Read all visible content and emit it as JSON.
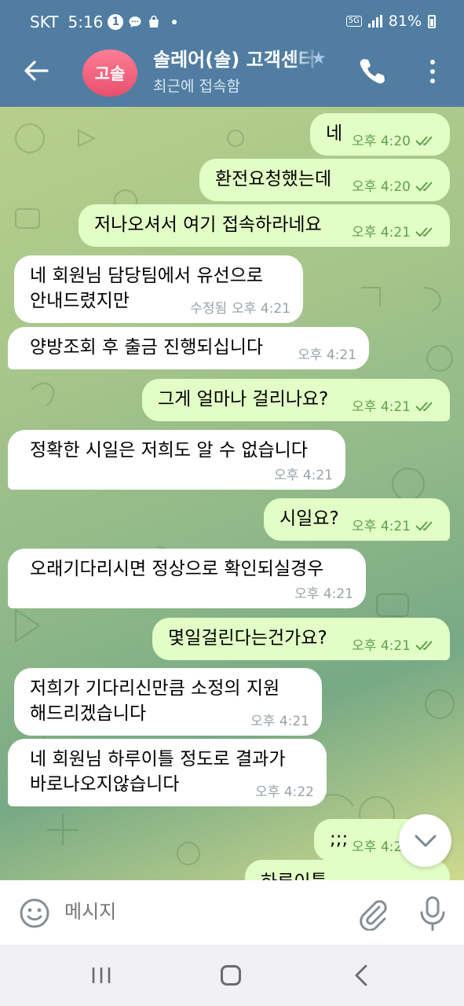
{
  "status_bar": {
    "carrier": "SKT",
    "time": "5:16",
    "notification_count": "1",
    "network": "5G",
    "battery": "81%"
  },
  "header": {
    "avatar_initials": "고솔",
    "title": "솔레어(솔) 고객센터",
    "subtitle": "최근에 접속함"
  },
  "messages": [
    {
      "dir": "out",
      "text": "네",
      "time": "오후 4:20"
    },
    {
      "dir": "out",
      "text": "환전요청했는데",
      "time": "오후 4:20"
    },
    {
      "dir": "out",
      "text": "저나오셔서 여기 접속하라네요",
      "time": "오후 4:21"
    },
    {
      "dir": "in",
      "lines": [
        "네 회원님 담당팀에서 유선으로",
        "안내드렸지만"
      ],
      "edited": "수정됨",
      "time": "오후 4:21"
    },
    {
      "dir": "in",
      "text": "양방조회 후 출금 진행되십니다",
      "time": "오후 4:21"
    },
    {
      "dir": "out",
      "text": "그게 얼마나 걸리나요?",
      "time": "오후 4:21"
    },
    {
      "dir": "in",
      "text": "정확한 시일은 저희도 알 수 없습니다",
      "time": "오후 4:21"
    },
    {
      "dir": "out",
      "text": "시일요?",
      "time": "오후 4:21"
    },
    {
      "dir": "in",
      "text": "오래기다리시면 정상으로 확인되실경우",
      "time": "오후 4:21"
    },
    {
      "dir": "out",
      "text": "몇일걸린다는건가요?",
      "time": "오후 4:21"
    },
    {
      "dir": "in",
      "lines": [
        "저희가 기다리신만큼 소정의 지원",
        "해드리겠습니다"
      ],
      "time": "오후 4:21"
    },
    {
      "dir": "in",
      "lines": [
        "네 회원님 하루이틀 정도로 결과가",
        "바로나오지않습니다"
      ],
      "time": "오후 4:22"
    },
    {
      "dir": "out",
      "text": ";;;",
      "time": "오후 4:21"
    },
    {
      "dir": "out",
      "text": "하루이틀.."
    }
  ],
  "composer": {
    "placeholder": "메시지"
  },
  "colors": {
    "header": "#517da2",
    "outgoing_bubble": "#e2fec6",
    "incoming_bubble": "#ffffff",
    "outgoing_meta": "#5fa04e",
    "avatar": "#e6506e"
  },
  "icons": [
    "back-arrow-icon",
    "star-icon",
    "phone-icon",
    "more-vertical-icon",
    "double-check-icon",
    "chevron-down-icon",
    "emoji-icon",
    "paperclip-icon",
    "microphone-icon",
    "recents-icon",
    "home-icon",
    "back-icon"
  ]
}
